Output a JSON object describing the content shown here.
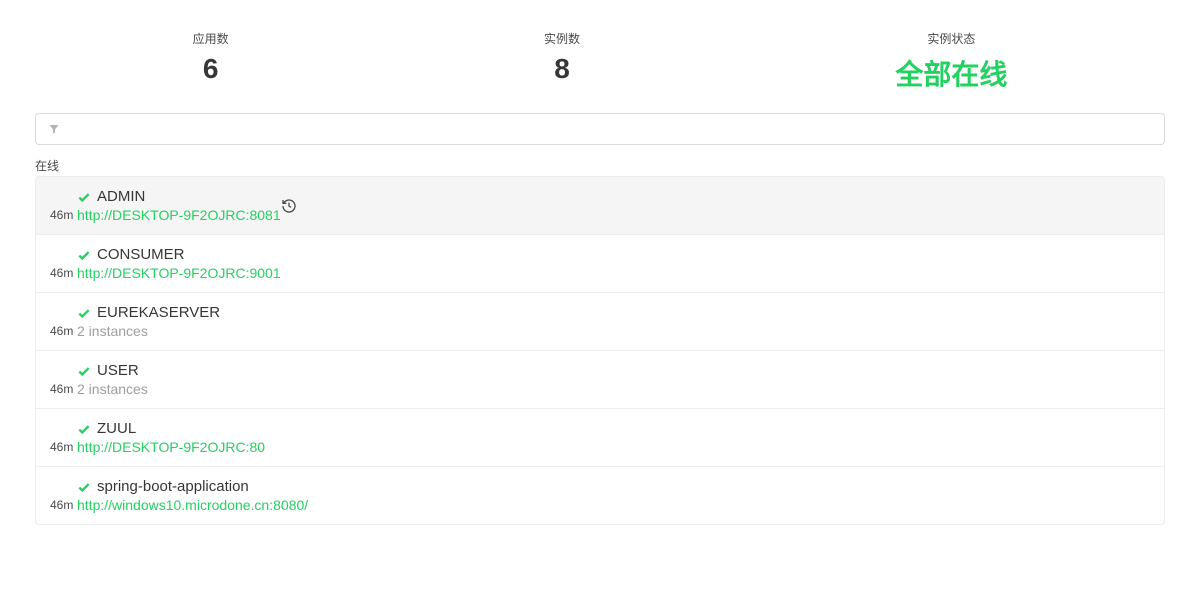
{
  "stats": {
    "apps": {
      "label": "应用数",
      "value": "6"
    },
    "instances": {
      "label": "实例数",
      "value": "8"
    },
    "status": {
      "label": "实例状态",
      "value": "全部在线"
    }
  },
  "filter": {
    "placeholder": ""
  },
  "sectionLabel": "在线",
  "apps": [
    {
      "time": "46m",
      "name": "ADMIN",
      "sub": "http://DESKTOP-9F2OJRC:8081",
      "subType": "link",
      "showHistory": true
    },
    {
      "time": "46m",
      "name": "CONSUMER",
      "sub": "http://DESKTOP-9F2OJRC:9001",
      "subType": "link",
      "showHistory": false
    },
    {
      "time": "46m",
      "name": "EUREKASERVER",
      "sub": "2 instances",
      "subType": "muted",
      "showHistory": false
    },
    {
      "time": "46m",
      "name": "USER",
      "sub": "2 instances",
      "subType": "muted",
      "showHistory": false
    },
    {
      "time": "46m",
      "name": "ZUUL",
      "sub": "http://DESKTOP-9F2OJRC:80",
      "subType": "link",
      "showHistory": false
    },
    {
      "time": "46m",
      "name": "spring-boot-application",
      "sub": "http://windows10.microdone.cn:8080/",
      "subType": "link",
      "showHistory": false
    }
  ],
  "watermark": ""
}
